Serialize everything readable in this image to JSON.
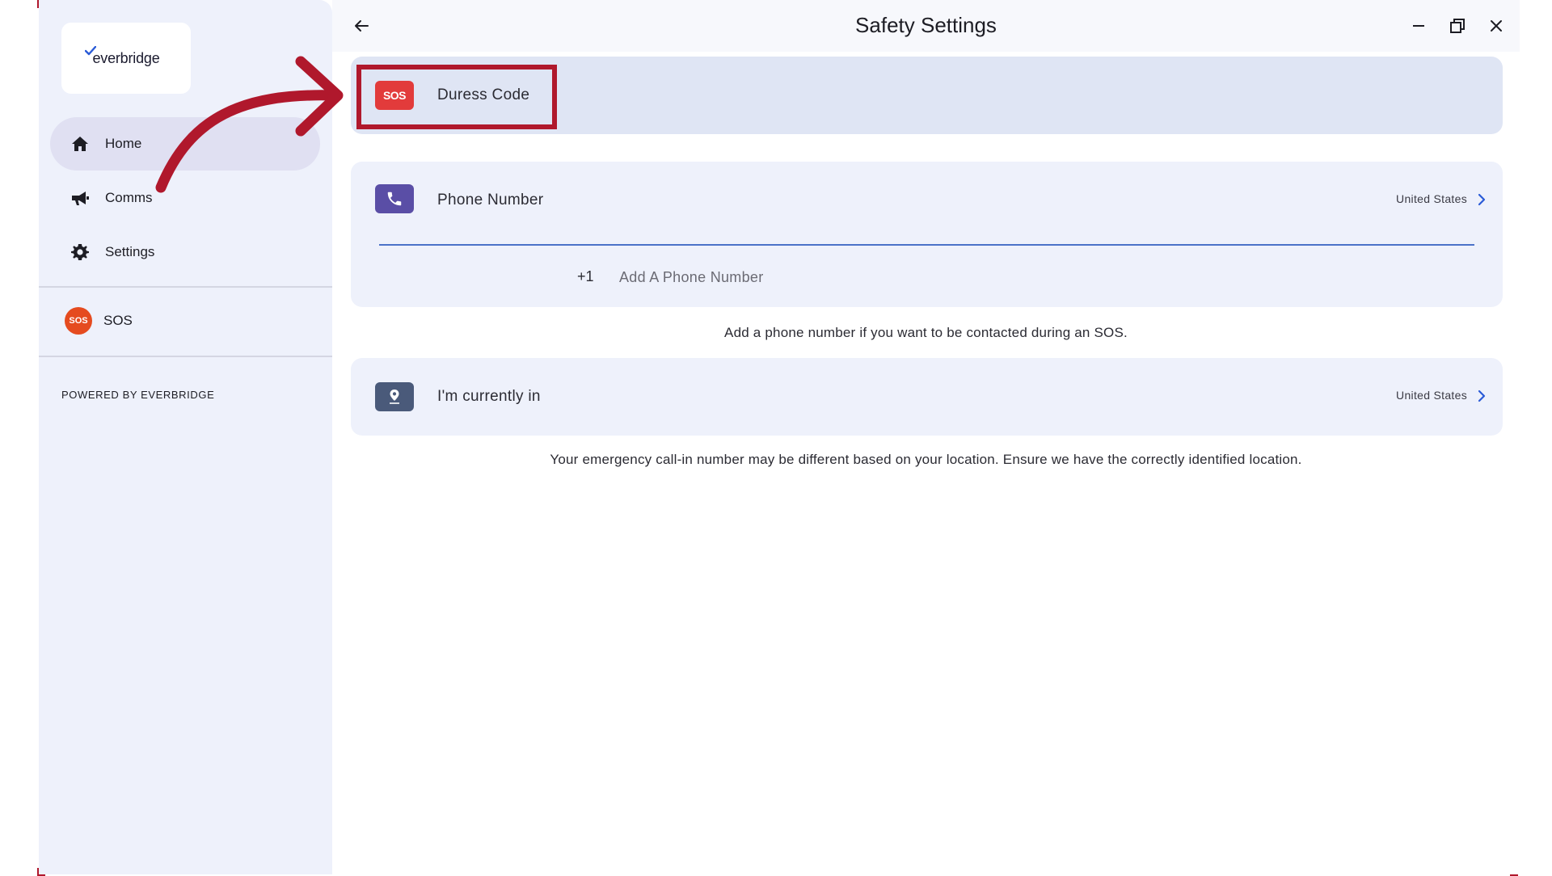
{
  "window": {
    "title": "Safety Settings"
  },
  "brand": {
    "logo_text": "everbridge",
    "powered_by": "POWERED BY EVERBRIDGE",
    "accent_color": "#b0182c"
  },
  "sidebar": {
    "items": [
      {
        "label": "Home",
        "icon": "home-icon",
        "active": true
      },
      {
        "label": "Comms",
        "icon": "megaphone-icon",
        "active": false
      },
      {
        "label": "Settings",
        "icon": "gear-icon",
        "active": false
      },
      {
        "label": "SOS",
        "icon": "sos-icon",
        "active": false,
        "badge": "SOS"
      }
    ]
  },
  "main": {
    "duress": {
      "label": "Duress Code",
      "badge": "SOS"
    },
    "phone": {
      "label": "Phone Number",
      "country": "United States",
      "country_code": "+1",
      "placeholder": "Add A Phone Number",
      "value": ""
    },
    "phone_helper": "Add a phone number if you want to be contacted during an SOS.",
    "location": {
      "label": "I'm currently in",
      "country": "United States"
    },
    "location_helper": "Your emergency call-in number may be different based on your location. Ensure we have the correctly identified location."
  }
}
